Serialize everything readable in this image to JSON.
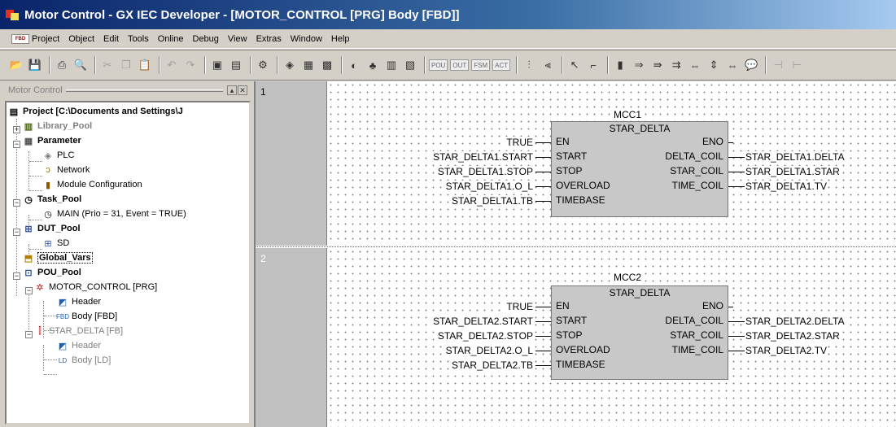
{
  "window": {
    "title": "Motor Control - GX IEC Developer - [MOTOR_CONTROL [PRG] Body [FBD]]"
  },
  "menu": {
    "logo": "FBD",
    "items": [
      "Project",
      "Object",
      "Edit",
      "Tools",
      "Online",
      "Debug",
      "View",
      "Extras",
      "Window",
      "Help"
    ]
  },
  "toolbar": {
    "text_buttons": [
      "POU",
      "OUT",
      "FSM",
      "ACT"
    ]
  },
  "navigator": {
    "title": "Motor Control",
    "root": "Project [C:\\Documents and Settings\\J",
    "library_pool": "Library_Pool",
    "parameter": "Parameter",
    "plc": "PLC",
    "network": "Network",
    "module_configuration": "Module Configuration",
    "task_pool": "Task_Pool",
    "main_task": "MAIN (Prio = 31, Event = TRUE)",
    "dut_pool": "DUT_Pool",
    "sd": "SD",
    "global_vars": "Global_Vars",
    "pou_pool": "POU_Pool",
    "motor_control": "MOTOR_CONTROL [PRG]",
    "header1": "Header",
    "body1": "Body [FBD]",
    "star_delta": "STAR_DELTA [FB]",
    "header2": "Header",
    "body2": "Body [LD]"
  },
  "networks": [
    {
      "number": "1",
      "instance": "MCC1",
      "fb_type": "STAR_DELTA",
      "in_pins": [
        "EN",
        "START",
        "STOP",
        "OVERLOAD",
        "TIMEBASE"
      ],
      "out_pins": [
        "ENO",
        "DELTA_COIL",
        "STAR_COIL",
        "TIME_COIL"
      ],
      "inputs": [
        "TRUE",
        "STAR_DELTA1.START",
        "STAR_DELTA1.STOP",
        "STAR_DELTA1.O_L",
        "STAR_DELTA1.TB"
      ],
      "outputs": [
        "STAR_DELTA1.DELTA",
        "STAR_DELTA1.STAR",
        "STAR_DELTA1.TV"
      ]
    },
    {
      "number": "2",
      "instance": "MCC2",
      "fb_type": "STAR_DELTA",
      "in_pins": [
        "EN",
        "START",
        "STOP",
        "OVERLOAD",
        "TIMEBASE"
      ],
      "out_pins": [
        "ENO",
        "DELTA_COIL",
        "STAR_COIL",
        "TIME_COIL"
      ],
      "inputs": [
        "TRUE",
        "STAR_DELTA2.START",
        "STAR_DELTA2.STOP",
        "STAR_DELTA2.O_L",
        "STAR_DELTA2.TB"
      ],
      "outputs": [
        "STAR_DELTA2.DELTA",
        "STAR_DELTA2.STAR",
        "STAR_DELTA2.TV"
      ]
    }
  ]
}
